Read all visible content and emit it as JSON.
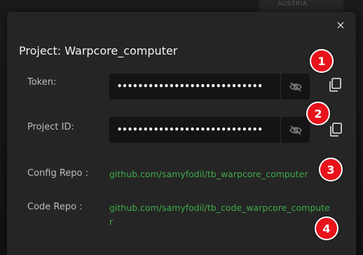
{
  "background": {
    "map_label": "AUSTRIA"
  },
  "modal": {
    "title": "Project: Warpcore_computer",
    "close_glyph": "×",
    "token": {
      "label": "Token:",
      "masked_value": "••••••••••••••••••••••••••••",
      "toggle_icon": "eye-off-icon",
      "copy_icon": "copy-icon"
    },
    "project_id": {
      "label": "Project ID:",
      "masked_value": "••••••••••••••••••••••••••••",
      "toggle_icon": "eye-off-icon",
      "copy_icon": "copy-icon"
    },
    "config_repo": {
      "label": "Config Repo :",
      "url": "github.com/samyfodil/tb_warpcore_computer"
    },
    "code_repo": {
      "label": "Code Repo :",
      "url_line1": "github.com/samyfodil/tb_code_warpcore_compute",
      "url_line2": "r"
    }
  },
  "annotations": [
    "1",
    "2",
    "3",
    "4"
  ],
  "colors": {
    "modal_bg": "#252525",
    "field_bg": "#141414",
    "link": "#3fa94a",
    "badge": "#e8121b"
  }
}
